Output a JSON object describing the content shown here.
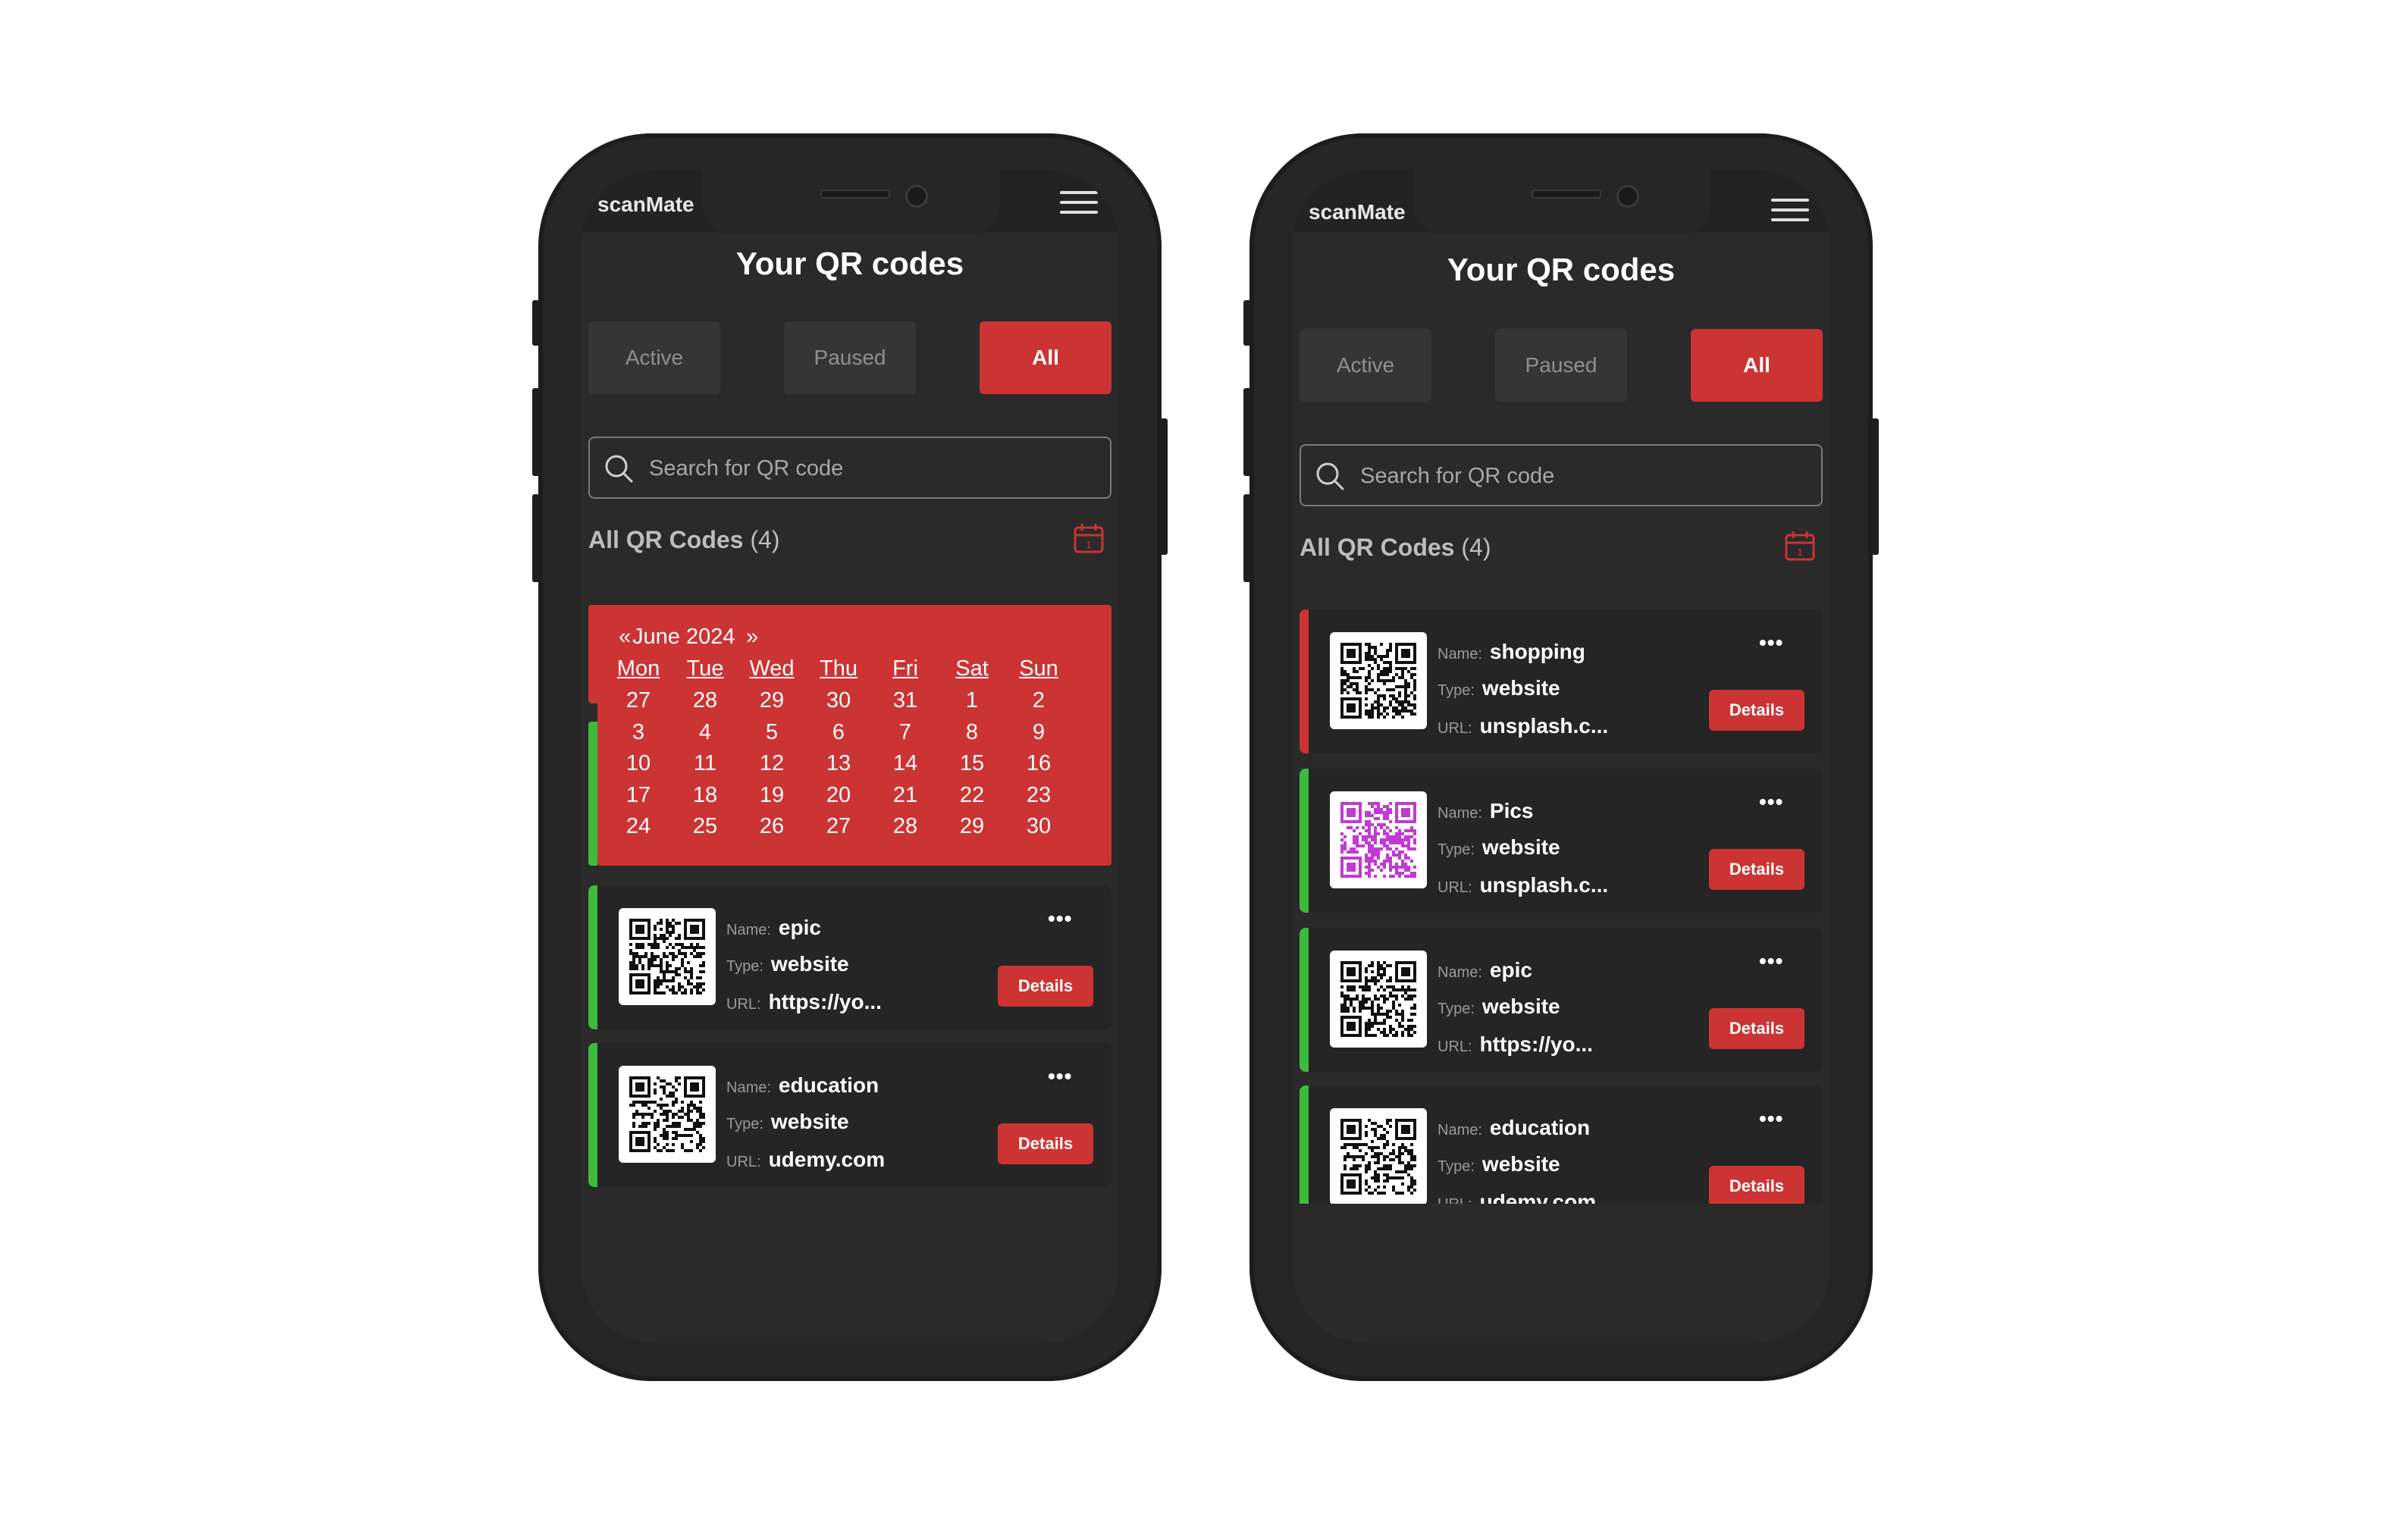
{
  "left_phone": {
    "brand": "scanMate",
    "title": "Your QR codes",
    "tabs": [
      {
        "label": "Active"
      },
      {
        "label": "Paused"
      },
      {
        "label": "All"
      }
    ],
    "search_placeholder": "Search for QR code",
    "section_title": "All QR Codes",
    "section_count": "(4)",
    "calendar": {
      "prev": "«",
      "month": "June 2024",
      "next": "»",
      "weekdays": [
        "Mon",
        "Tue",
        "Wed",
        "Thu",
        "Fri",
        "Sat",
        "Sun"
      ],
      "weeks": [
        [
          "27",
          "28",
          "29",
          "30",
          "31",
          "1",
          "2"
        ],
        [
          "3",
          "4",
          "5",
          "6",
          "7",
          "8",
          "9"
        ],
        [
          "10",
          "11",
          "12",
          "13",
          "14",
          "15",
          "16"
        ],
        [
          "17",
          "18",
          "19",
          "20",
          "21",
          "22",
          "23"
        ],
        [
          "24",
          "25",
          "26",
          "27",
          "28",
          "29",
          "30"
        ]
      ]
    },
    "cards": [
      {
        "name_label": "Name:",
        "name": "epic",
        "type_label": "Type:",
        "type": "website",
        "url_label": "URL:",
        "url": "https://yo...",
        "details": "Details",
        "more": "•••"
      },
      {
        "name_label": "Name:",
        "name": "education",
        "type_label": "Type:",
        "type": "website",
        "url_label": "URL:",
        "url": "udemy.com",
        "details": "Details",
        "more": "•••"
      }
    ]
  },
  "right_phone": {
    "brand": "scanMate",
    "title": "Your QR codes",
    "tabs": [
      {
        "label": "Active"
      },
      {
        "label": "Paused"
      },
      {
        "label": "All"
      }
    ],
    "search_placeholder": "Search for QR code",
    "section_title": "All QR Codes",
    "section_count": "(4)",
    "cards": [
      {
        "name_label": "Name:",
        "name": "shopping",
        "type_label": "Type:",
        "type": "website",
        "url_label": "URL:",
        "url": "unsplash.c...",
        "details": "Details",
        "more": "•••"
      },
      {
        "name_label": "Name:",
        "name": "Pics",
        "type_label": "Type:",
        "type": "website",
        "url_label": "URL:",
        "url": "unsplash.c...",
        "details": "Details",
        "more": "•••"
      },
      {
        "name_label": "Name:",
        "name": "epic",
        "type_label": "Type:",
        "type": "website",
        "url_label": "URL:",
        "url": "https://yo...",
        "details": "Details",
        "more": "•••"
      },
      {
        "name_label": "Name:",
        "name": "education",
        "type_label": "Type:",
        "type": "website",
        "url_label": "URL:",
        "url": "udemy.com",
        "details": "Details",
        "more": "•••"
      }
    ]
  },
  "colors": {
    "accent": "#cc3333",
    "active_stripe": "#3dbb3d",
    "paused_stripe": "#cc3333",
    "background": "#2a2a2a",
    "qr_purple": "#c13ad1"
  },
  "icons": {
    "menu": "hamburger-icon",
    "search": "search-icon",
    "calendar": "calendar-icon",
    "more": "more-icon"
  }
}
